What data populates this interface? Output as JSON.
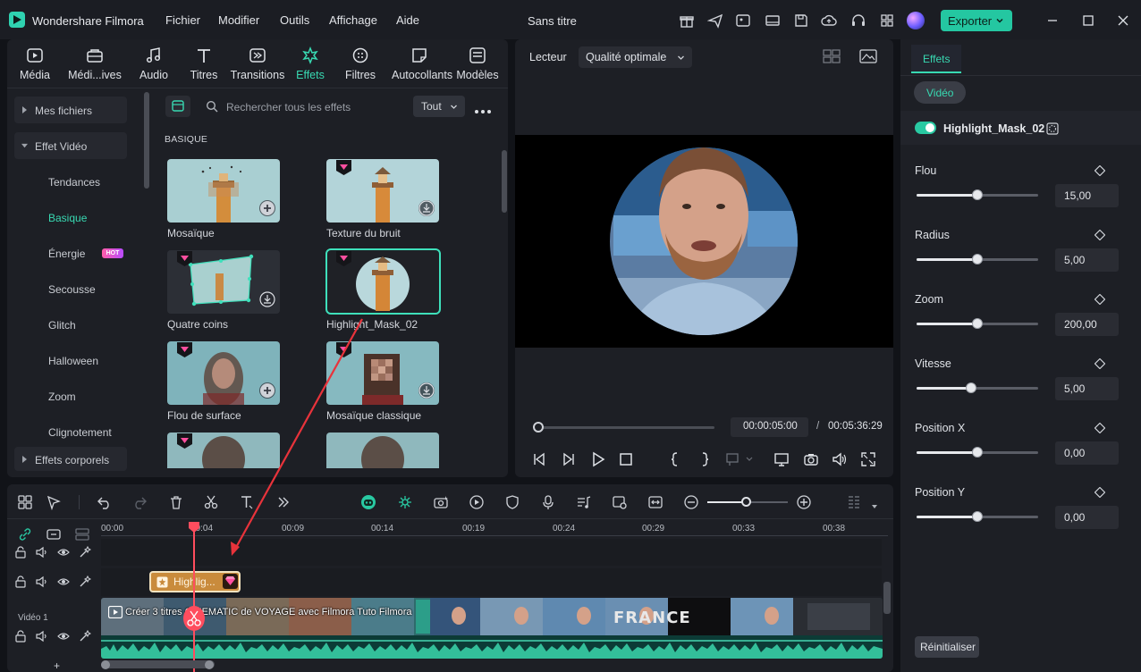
{
  "app": {
    "name": "Wondershare Filmora",
    "doc_title": "Sans titre",
    "menu": [
      "Fichier",
      "Modifier",
      "Outils",
      "Affichage",
      "Aide"
    ],
    "export_label": "Exporter"
  },
  "media_tabs": [
    {
      "label": "Média",
      "icon": "media-icon"
    },
    {
      "label": "Médi...ives",
      "icon": "stock-media-icon"
    },
    {
      "label": "Audio",
      "icon": "music-note-icon"
    },
    {
      "label": "Titres",
      "icon": "text-icon"
    },
    {
      "label": "Transitions",
      "icon": "transition-icon"
    },
    {
      "label": "Effets",
      "icon": "effects-icon",
      "active": true
    },
    {
      "label": "Filtres",
      "icon": "filter-icon"
    },
    {
      "label": "Autocollants",
      "icon": "sticker-icon"
    },
    {
      "label": "Modèles",
      "icon": "template-icon"
    }
  ],
  "nav": {
    "my_files": "Mes fichiers",
    "video_effect": "Effet Vidéo",
    "sub_items": [
      "Tendances",
      "Basique",
      "Énergie",
      "Secousse",
      "Glitch",
      "Halloween",
      "Zoom",
      "Clignotement"
    ],
    "active_sub": "Basique",
    "hot_badge": "HOT",
    "body_effects": "Effets corporels"
  },
  "search": {
    "placeholder": "Rechercher tous les effets",
    "filter": "Tout"
  },
  "section_label": "BASIQUE",
  "effects": [
    {
      "label": "Mosaïque",
      "premium": false,
      "action": "add"
    },
    {
      "label": "Texture du bruit",
      "premium": true,
      "action": "download"
    },
    {
      "label": "Quatre coins",
      "premium": true,
      "action": "download"
    },
    {
      "label": "Highlight_Mask_02",
      "premium": true,
      "action": "none",
      "selected": true
    },
    {
      "label": "Flou de surface",
      "premium": true,
      "action": "add"
    },
    {
      "label": "Mosaïque classique",
      "premium": true,
      "action": "download"
    }
  ],
  "player": {
    "label": "Lecteur",
    "quality": "Qualité optimale",
    "current_time": "00:00:05:00",
    "separator": "/",
    "total_time": "00:05:36:29",
    "progress_fraction": 0.015
  },
  "props": {
    "tab": "Effets",
    "chip": "Vidéo",
    "effect_name": "Highlight_Mask_02",
    "enabled": true,
    "params": [
      {
        "label": "Flou",
        "value": "15,00",
        "fraction": 0.5
      },
      {
        "label": "Radius",
        "value": "5,00",
        "fraction": 0.5
      },
      {
        "label": "Zoom",
        "value": "200,00",
        "fraction": 0.5
      },
      {
        "label": "Vitesse",
        "value": "5,00",
        "fraction": 0.45
      },
      {
        "label": "Position X",
        "value": "0,00",
        "fraction": 0.5
      },
      {
        "label": "Position Y",
        "value": "0,00",
        "fraction": 0.5
      }
    ],
    "reset_label": "Réinitialiser"
  },
  "timeline": {
    "ruler": [
      "00:00",
      "00:04",
      "00:09",
      "00:14",
      "00:19",
      "00:24",
      "00:29",
      "00:33",
      "00:38"
    ],
    "effect_clip_label": "Highlig...",
    "video_track_label": "Vidéo 1",
    "video_clip_title": "Créer 3 titres CINEMATIC de VOYAGE avec Filmora  Tuto Filmora",
    "france_text": "FRANCE",
    "add_track": "+"
  },
  "colors": {
    "accent": "#38d9b2",
    "export": "#24c7a1",
    "effect_clip": "#c98b3c",
    "playhead": "#ff4d5e",
    "annotation_arrow": "#e8333b",
    "gem": "#ff4fa0"
  }
}
